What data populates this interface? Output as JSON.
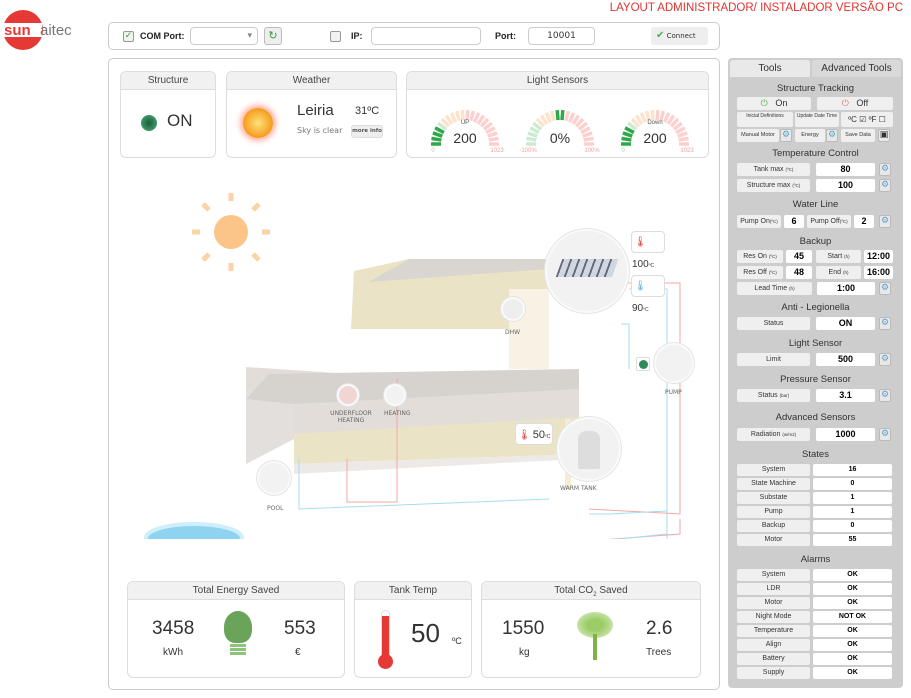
{
  "header": {
    "title": "LAYOUT ADMINISTRADOR/ INSTALADOR VERSÃO PC",
    "logo_text": "sunaitec"
  },
  "connection": {
    "com_checked": true,
    "com_label": "COM Port:",
    "com_value": "",
    "ip_checked": false,
    "ip_label": "IP:",
    "ip_value": "",
    "port_label": "Port:",
    "port_value": "10001",
    "connect_label": "Connect"
  },
  "structure": {
    "title": "Structure",
    "status": "ON",
    "led_color": "#2e8b57"
  },
  "weather": {
    "title": "Weather",
    "city": "Leiria",
    "temp": "31ºC",
    "description": "Sky is clear",
    "more_label": "more info"
  },
  "light_sensors": {
    "title": "Light Sensors",
    "gauges": [
      {
        "label": "UP",
        "value": "200",
        "min": "0",
        "max": "1023",
        "fraction": 0.2
      },
      {
        "label": "",
        "value": "0%",
        "min": "-100%",
        "max": "100%",
        "fraction": 0.5
      },
      {
        "label": "Down",
        "value": "200",
        "min": "0",
        "max": "1023",
        "fraction": 0.2
      }
    ]
  },
  "diagram": {
    "solar_temp": "100",
    "return_temp": "90",
    "tank_temp": "50",
    "unit": "ºC",
    "labels": {
      "dhw": "DHW",
      "underfloor": "UNDERFLOOR HEATING",
      "heating": "HEATING",
      "pump": "PUMP",
      "tank": "WARM TANK",
      "pool": "POOL"
    },
    "pump_led_color": "#2e8b57",
    "hot_pipe": "#f4a6a6",
    "cold_pipe": "#a6dcef"
  },
  "energy": {
    "title": "Total Energy Saved",
    "kwh": "3458",
    "kwh_unit": "kWh",
    "money": "553",
    "money_unit": "€"
  },
  "tank": {
    "title": "Tank Temp",
    "value": "50",
    "unit": "ºC"
  },
  "co2": {
    "title_pre": "Total CO",
    "title_sub": "2",
    "title_post": " Saved",
    "kg": "1550",
    "kg_unit": "kg",
    "trees": "2.6",
    "trees_unit": "Trees"
  },
  "side": {
    "tabs": [
      "Tools",
      "Advanced Tools"
    ],
    "tracking": {
      "title": "Structure Tracking",
      "on": "On",
      "off": "Off",
      "initial": "Inicial Definitions",
      "update": "Update Date Time",
      "celsius": "ºC",
      "fahrenheit": "ºF",
      "manual": "Manual Motor",
      "energy": "Energy",
      "save": "Save Data"
    },
    "temp_control": {
      "title": "Temperature Control",
      "tank_label": "Tank max",
      "tank_unit": "(ºC)",
      "tank_value": "80",
      "struct_label": "Structure max",
      "struct_unit": "(ºC)",
      "struct_value": "100"
    },
    "water_line": {
      "title": "Water Line",
      "on_label": "Pump On",
      "on_value": "6",
      "off_label": "Pump Off",
      "off_value": "2",
      "unit": "(ºC)"
    },
    "backup": {
      "title": "Backup",
      "res_on_label": "Res On",
      "res_on": "45",
      "start_label": "Start",
      "start": "12:00",
      "res_off_label": "Res Off",
      "res_off": "48",
      "end_label": "End",
      "end": "16:00",
      "lead_label": "Lead Time",
      "lead": "1:00",
      "unit_c": "(ºC)",
      "unit_h": "(h)"
    },
    "legionella": {
      "title": "Anti - Legionella",
      "label": "Status",
      "value": "ON"
    },
    "light": {
      "title": "Light Sensor",
      "label": "Limit",
      "value": "500"
    },
    "pressure": {
      "title": "Pressure Sensor",
      "label": "Status",
      "unit": "(bar)",
      "value": "3.1"
    },
    "advanced": {
      "title": "Advanced Sensors",
      "label": "Radiation",
      "unit": "(w/m2)",
      "value": "1000"
    },
    "states": {
      "title": "States",
      "rows": [
        {
          "label": "System",
          "value": "16"
        },
        {
          "label": "State Machine",
          "value": "0"
        },
        {
          "label": "Substate",
          "value": "1"
        },
        {
          "label": "Pump",
          "value": "1"
        },
        {
          "label": "Backup",
          "value": "0"
        },
        {
          "label": "Motor",
          "value": "55"
        }
      ]
    },
    "alarms": {
      "title": "Alarms",
      "rows": [
        {
          "label": "System",
          "value": "OK"
        },
        {
          "label": "LDR",
          "value": "OK"
        },
        {
          "label": "Motor",
          "value": "OK"
        },
        {
          "label": "Night Mode",
          "value": "NOT OK"
        },
        {
          "label": "Temperature",
          "value": "OK"
        },
        {
          "label": "Align",
          "value": "OK"
        },
        {
          "label": "Battery",
          "value": "OK"
        },
        {
          "label": "Supply",
          "value": "OK"
        }
      ]
    }
  }
}
